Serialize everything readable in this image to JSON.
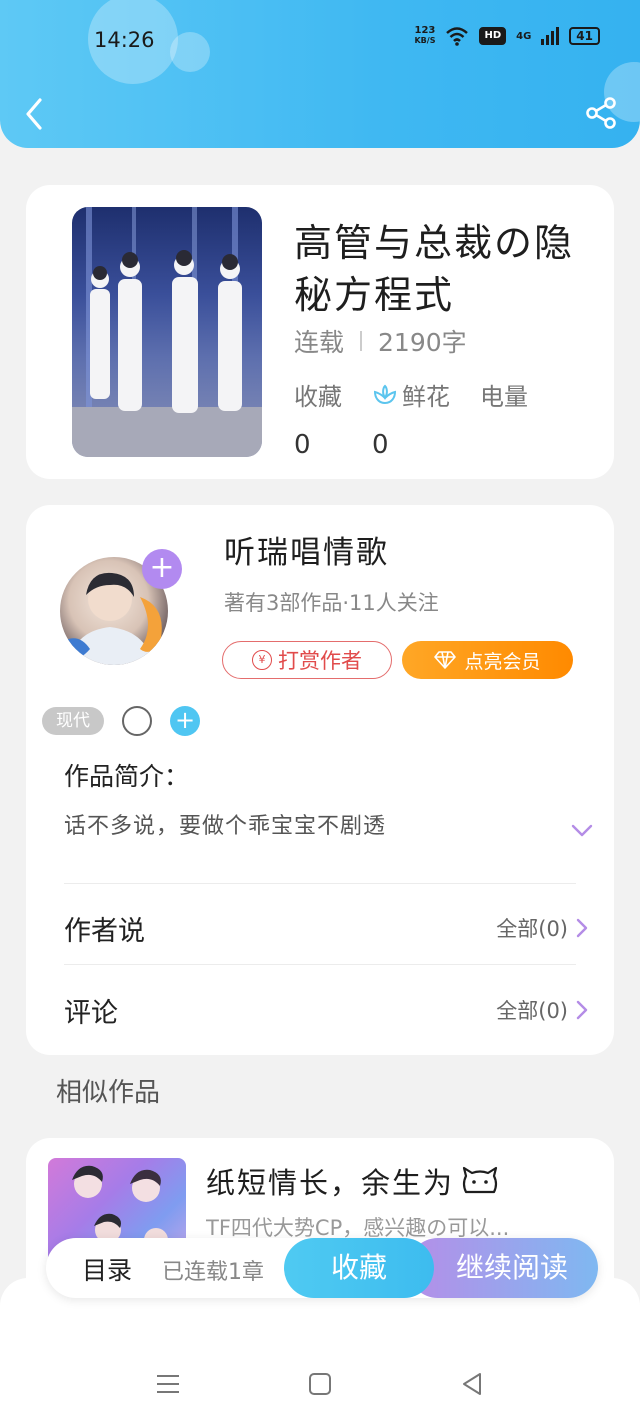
{
  "status_bar": {
    "time": "14:26",
    "net_speed_top": "123",
    "net_speed_bottom": "KB/S",
    "hd": "HD",
    "signal": "4G",
    "battery": "41"
  },
  "icons": {
    "back": "chevron-left-icon",
    "share": "share-icon",
    "flower": "flower-icon",
    "coin": "yen-coin-icon",
    "diamond": "diamond-icon",
    "expand": "chevron-down-icon",
    "arrow": "chevron-right-icon"
  },
  "colors": {
    "header": "#3fb8f2",
    "accent_purple": "#b28af0",
    "tip_red": "#e14b4b",
    "vip_orange": "#ff8a00"
  },
  "book": {
    "title": "高管与总裁の隐秘方程式",
    "status": "连载",
    "word_count": "2190字",
    "stats": [
      {
        "label": "收藏",
        "value": "0"
      },
      {
        "label": "鲜花",
        "value": "0"
      },
      {
        "label": "电量",
        "value": ""
      }
    ]
  },
  "author": {
    "name": "听瑞唱情歌",
    "subtitle": "著有3部作品·11人关注",
    "tip_label": "打赏作者",
    "tip_coin": "¥",
    "vip_label": "点亮会员"
  },
  "tags": [
    "现代"
  ],
  "intro": {
    "label": "作品简介：",
    "text": "话不多说，要做个乖宝宝不剧透"
  },
  "rows": [
    {
      "label": "作者说",
      "right": "全部(0)"
    },
    {
      "label": "评论",
      "right": "全部(0)"
    }
  ],
  "similar": {
    "section_title": "相似作品",
    "items": [
      {
        "title": "纸短情长，余生为",
        "desc": "TF四代大势CP，感兴趣の可以..."
      }
    ]
  },
  "action_bar": {
    "toc": "目录",
    "chapter_count": "已连载1章",
    "favorite": "收藏",
    "continue": "继续阅读"
  }
}
